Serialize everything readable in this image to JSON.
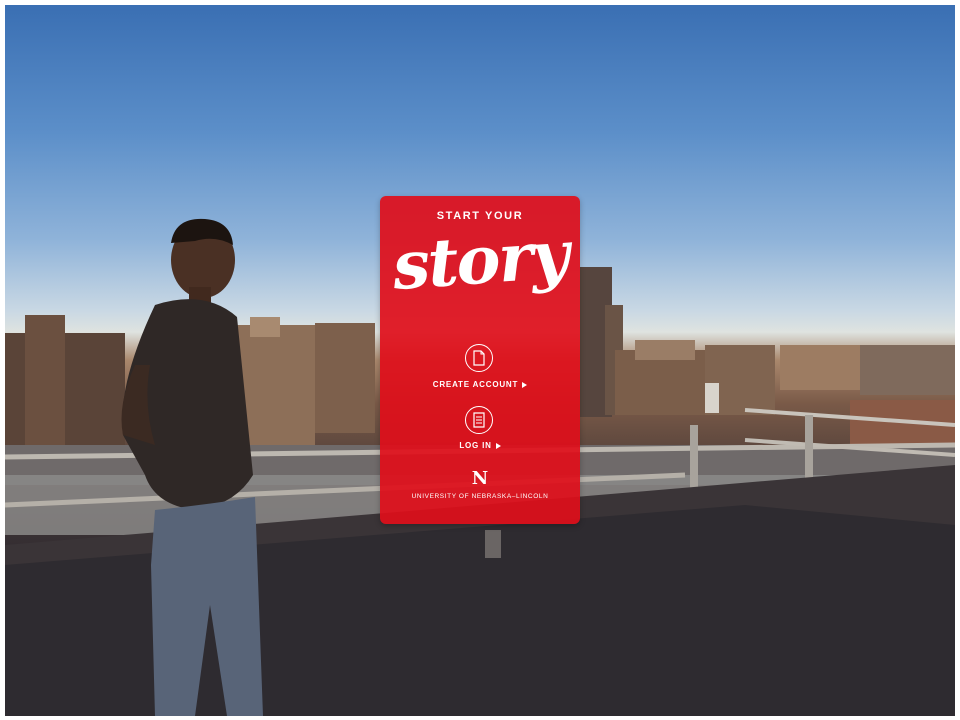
{
  "hero": {
    "eyebrow": "START YOUR",
    "headline_script": "story"
  },
  "actions": {
    "create_account_label": "CREATE ACCOUNT",
    "log_in_label": "LOG IN"
  },
  "branding": {
    "logo_letter": "N",
    "university_name": "UNIVERSITY OF NEBRASKA–LINCOLN"
  },
  "colors": {
    "brand_red": "#E00E1A",
    "text": "#FFFFFF"
  },
  "icons": {
    "create_account": "new-document-icon",
    "log_in": "document-lines-icon"
  }
}
